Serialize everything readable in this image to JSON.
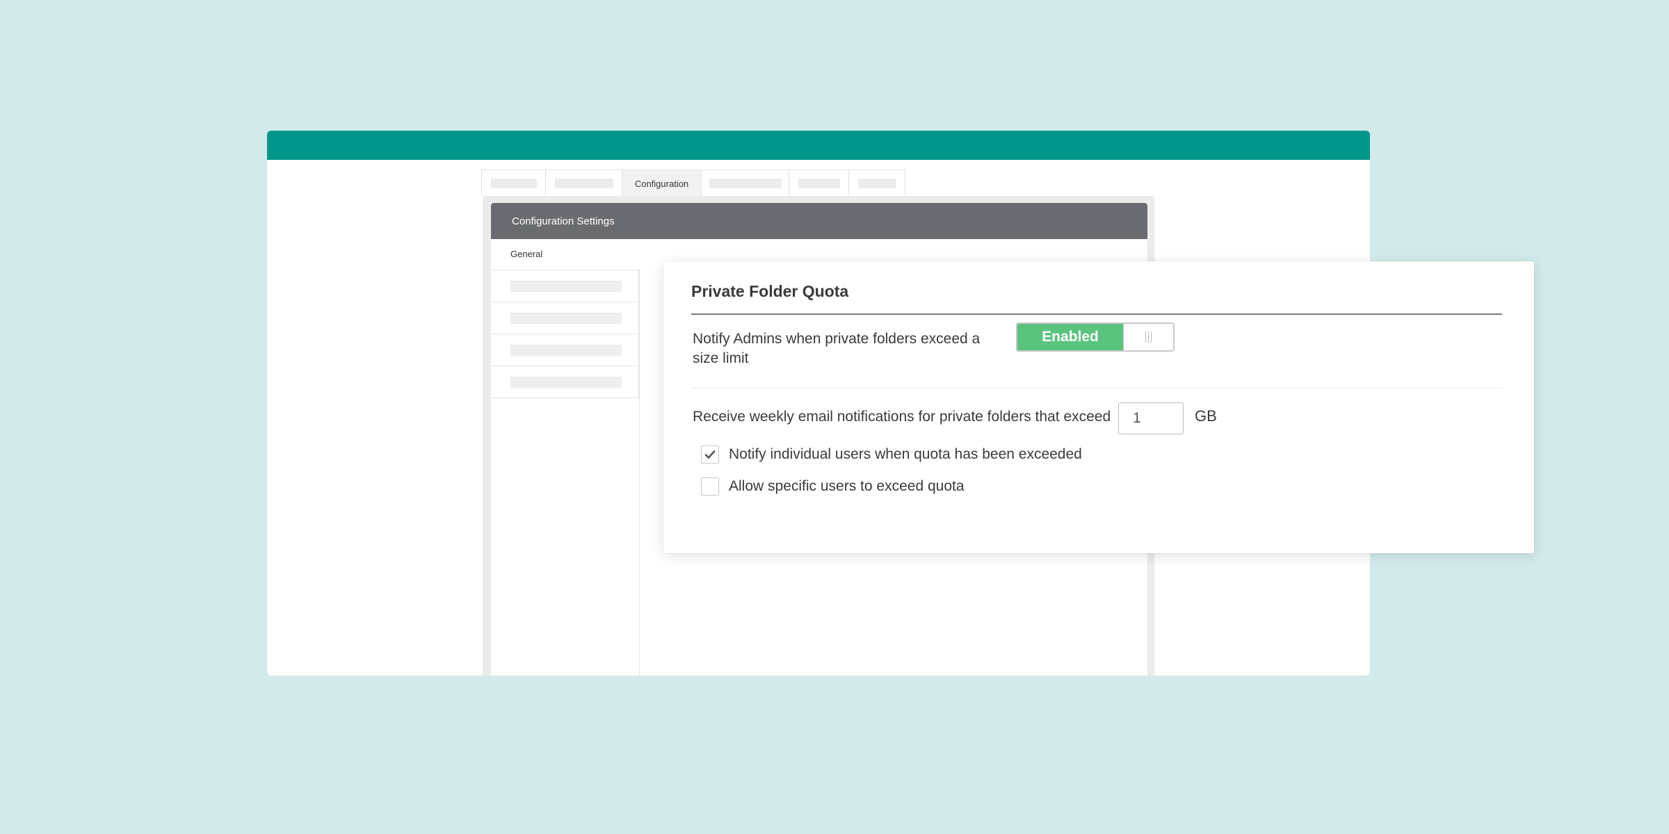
{
  "tabs": {
    "active_label": "Configuration"
  },
  "panel": {
    "title": "Configuration Settings",
    "sidebar_heading": "General"
  },
  "quota": {
    "title": "Private Folder Quota",
    "notify_admins_label": "Notify Admins when private folders exceed a size limit",
    "toggle_label": "Enabled",
    "toggle_state": "enabled",
    "weekly_label": "Receive weekly email notifications for private folders that exceed",
    "threshold_value": "1",
    "threshold_unit": "GB",
    "options": [
      {
        "label": "Notify individual users when quota has been exceeded",
        "checked": true
      },
      {
        "label": "Allow specific users to exceed quota",
        "checked": false
      }
    ]
  },
  "colors": {
    "background": "#d3eaea",
    "brand_bar": "#00968a",
    "panel_header": "#6a6b70",
    "toggle_enabled": "#5ac47e"
  }
}
